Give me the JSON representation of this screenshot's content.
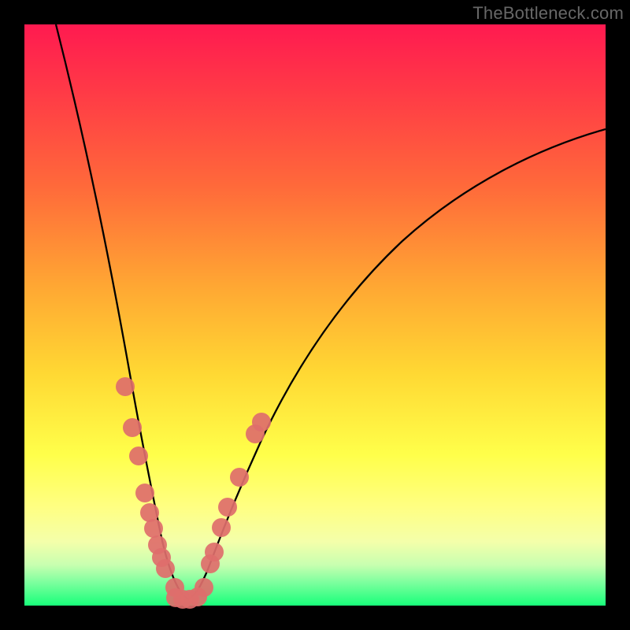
{
  "watermark": "TheBottleneck.com",
  "colors": {
    "frame": "#000000",
    "watermark_text": "#676767",
    "dot_fill": "#de6e6b",
    "curve_stroke": "#000000",
    "gradient_top": "#ff1a50",
    "gradient_bottom": "#18ff7a"
  },
  "chart_data": {
    "type": "line",
    "title": "",
    "xlabel": "",
    "ylabel": "",
    "xlim": [
      0,
      100
    ],
    "ylim": [
      0,
      100
    ],
    "grid": false,
    "legend": false,
    "note": "Two curved traces forming a trough near x≈25; values below are approximate pixel-normalized coordinates (0–100 each axis, y=0 at bottom).",
    "series": [
      {
        "name": "left-curve",
        "x": [
          5.5,
          10,
          13,
          16,
          18,
          19.5,
          21,
          22.5,
          24,
          25,
          26.5,
          28
        ],
        "y": [
          100,
          70,
          53,
          38,
          28,
          21,
          14.5,
          9.5,
          5.5,
          3,
          1.8,
          1
        ]
      },
      {
        "name": "right-curve",
        "x": [
          28,
          30,
          32,
          34,
          37,
          42,
          48,
          55,
          65,
          78,
          90,
          100
        ],
        "y": [
          1,
          3.5,
          9.5,
          15,
          23,
          35,
          46,
          55,
          65,
          74,
          79,
          82
        ]
      }
    ],
    "markers": [
      {
        "series": "left-curve",
        "x": 16.0,
        "y": 38
      },
      {
        "series": "left-curve",
        "x": 17.5,
        "y": 31
      },
      {
        "series": "left-curve",
        "x": 18.6,
        "y": 26
      },
      {
        "series": "left-curve",
        "x": 19.8,
        "y": 19.5
      },
      {
        "series": "left-curve",
        "x": 20.6,
        "y": 16
      },
      {
        "series": "left-curve",
        "x": 21.3,
        "y": 13.5
      },
      {
        "series": "left-curve",
        "x": 22.0,
        "y": 10.5
      },
      {
        "series": "left-curve",
        "x": 22.7,
        "y": 8.3
      },
      {
        "series": "left-curve",
        "x": 23.4,
        "y": 6.5
      },
      {
        "series": "left-curve",
        "x": 25.0,
        "y": 3.3
      },
      {
        "series": "trough",
        "x": 25.2,
        "y": 1.2
      },
      {
        "series": "trough",
        "x": 26.3,
        "y": 0.9
      },
      {
        "series": "trough",
        "x": 27.6,
        "y": 0.9
      },
      {
        "series": "trough",
        "x": 28.9,
        "y": 1.4
      },
      {
        "series": "right-curve",
        "x": 30.0,
        "y": 3.0
      },
      {
        "series": "right-curve",
        "x": 31.0,
        "y": 7.0
      },
      {
        "series": "right-curve",
        "x": 31.8,
        "y": 9.0
      },
      {
        "series": "right-curve",
        "x": 33.0,
        "y": 13.5
      },
      {
        "series": "right-curve",
        "x": 34.2,
        "y": 17.0
      },
      {
        "series": "right-curve",
        "x": 36.2,
        "y": 22.0
      },
      {
        "series": "right-curve",
        "x": 39.0,
        "y": 29.5
      },
      {
        "series": "right-curve",
        "x": 40.0,
        "y": 31.5
      }
    ]
  }
}
